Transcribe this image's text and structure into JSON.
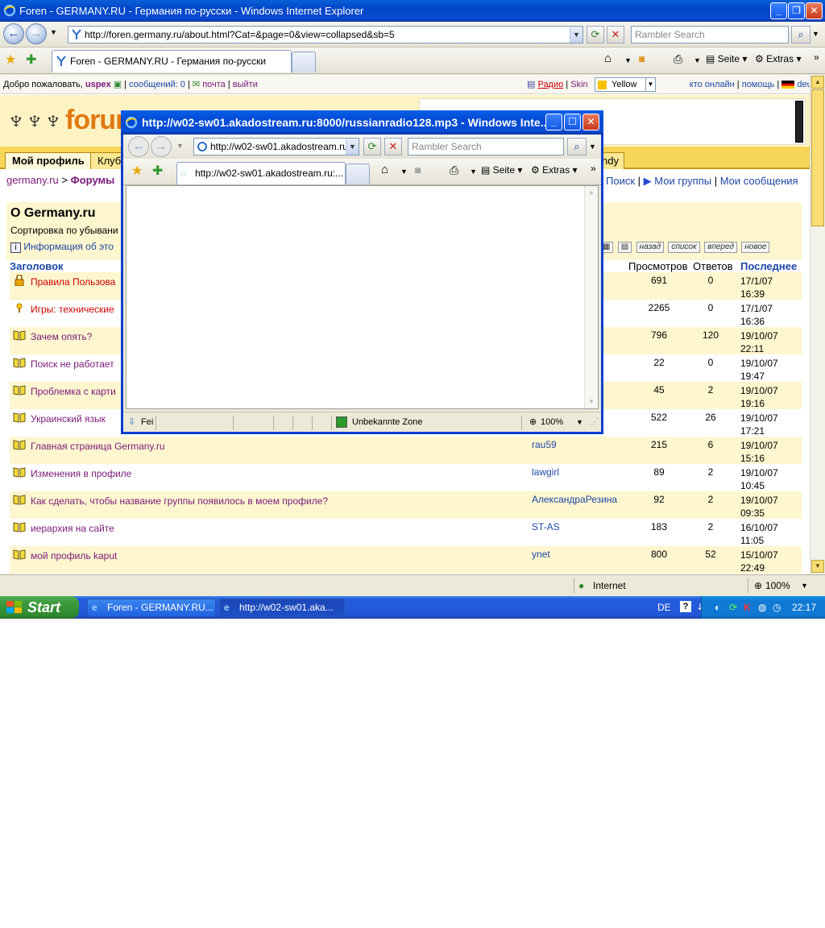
{
  "main_window": {
    "title": "Foren - GERMANY.RU - Германия по-русски - Windows Internet Explorer",
    "address": "http://foren.germany.ru/about.html?Cat=&page=0&view=collapsed&sb=5",
    "search_placeholder": "Rambler Search",
    "tab_label": "Foren - GERMANY.RU - Германия по-русски",
    "page_menu": "Seite",
    "tools_menu": "Extras"
  },
  "page": {
    "welcome": "Добро пожаловать,",
    "username": "uspex",
    "messages": "сообщений: 0",
    "mail": "почта",
    "logout": "выйти",
    "radio": "Радио",
    "skin_label": "Skin",
    "skin_value": "Yellow",
    "who_online": "кто онлайн",
    "help": "помощь",
    "language": "deutsch",
    "logo_text": "forum",
    "menu": {
      "my_profile": "Мой профиль",
      "club": "Клуб",
      "friendly": "ndy"
    },
    "breadcrumb_home": "germany.ru",
    "breadcrumb_sep": ">",
    "breadcrumb_forums": "Форумы",
    "search_link": "Поиск",
    "my_groups": "Мои группы",
    "my_messages": "Мои сообщения",
    "section_title": "О Germany.ru",
    "sort_text": "Сортировка по убывани",
    "info_text": "Информация об это",
    "nav_buttons": {
      "back": "назад",
      "list": "список",
      "forward": "вперед",
      "new": "новое"
    },
    "columns": {
      "subject": "Заголовок",
      "views": "Просмотров",
      "replies": "Ответов",
      "last": "Последнее"
    },
    "threads": [
      {
        "icon": "lock",
        "title": "Правила Пользова",
        "author": "",
        "views": "691",
        "replies": "0",
        "date": "17/1/07",
        "time": "16:39"
      },
      {
        "icon": "bulb",
        "title": "Игры: технические",
        "author": "",
        "views": "2265",
        "replies": "0",
        "date": "17/1/07",
        "time": "16:36"
      },
      {
        "icon": "book",
        "title": "Зачем опять?",
        "author": "",
        "views": "796",
        "replies": "120",
        "date": "19/10/07",
        "time": "22:11"
      },
      {
        "icon": "book",
        "title": "Поиск не работает",
        "author": "",
        "views": "22",
        "replies": "0",
        "date": "19/10/07",
        "time": "19:47"
      },
      {
        "icon": "book",
        "title": "Проблемка с карти",
        "author": "",
        "views": "45",
        "replies": "2",
        "date": "19/10/07",
        "time": "19:16"
      },
      {
        "icon": "book",
        "title": "Украинский язык",
        "author": "",
        "views": "522",
        "replies": "26",
        "date": "19/10/07",
        "time": "17:21"
      },
      {
        "icon": "book",
        "title": "Главная страница Germany.ru",
        "author": "rau59",
        "views": "215",
        "replies": "6",
        "date": "19/10/07",
        "time": "15:16"
      },
      {
        "icon": "book",
        "title": "Изменения в профиле",
        "author": "lawgirl",
        "views": "89",
        "replies": "2",
        "date": "19/10/07",
        "time": "10:45"
      },
      {
        "icon": "book",
        "title": "Как сделать, чтобы название группы появилось в моем профиле?",
        "author": "АлександраРезина",
        "views": "92",
        "replies": "2",
        "date": "19/10/07",
        "time": "09:35"
      },
      {
        "icon": "book",
        "title": "иерархия на сайте",
        "author": "ST-AS",
        "views": "183",
        "replies": "2",
        "date": "16/10/07",
        "time": "11:05"
      },
      {
        "icon": "book",
        "title": "мой профиль kaput",
        "author": "ynet",
        "views": "800",
        "replies": "52",
        "date": "15/10/07",
        "time": "22:49"
      }
    ]
  },
  "main_status": {
    "zone": "Internet",
    "zoom": "100%"
  },
  "popup": {
    "title": "http://w02-sw01.akadostream.ru:8000/russianradio128.mp3 - Windows Inte...",
    "address": "http://w02-sw01.akadostream.ru:",
    "search_placeholder": "Rambler Search",
    "tab_label": "http://w02-sw01.akadostream.ru:...",
    "page_menu": "Seite",
    "tools_menu": "Extras",
    "status_left": "Fei",
    "zone": "Unbekannte Zone",
    "zoom": "100%"
  },
  "taskbar": {
    "start": "Start",
    "task1": "Foren - GERMANY.RU...",
    "task2": "http://w02-sw01.aka...",
    "lang": "DE",
    "clock": "22:17"
  },
  "colors": {
    "accent_blue": "#0a4ad0",
    "forum_yellow": "#f7d657",
    "row_alt": "#fdf6cf",
    "link_purple": "#7a1a7a",
    "link_red": "#cc0000"
  }
}
